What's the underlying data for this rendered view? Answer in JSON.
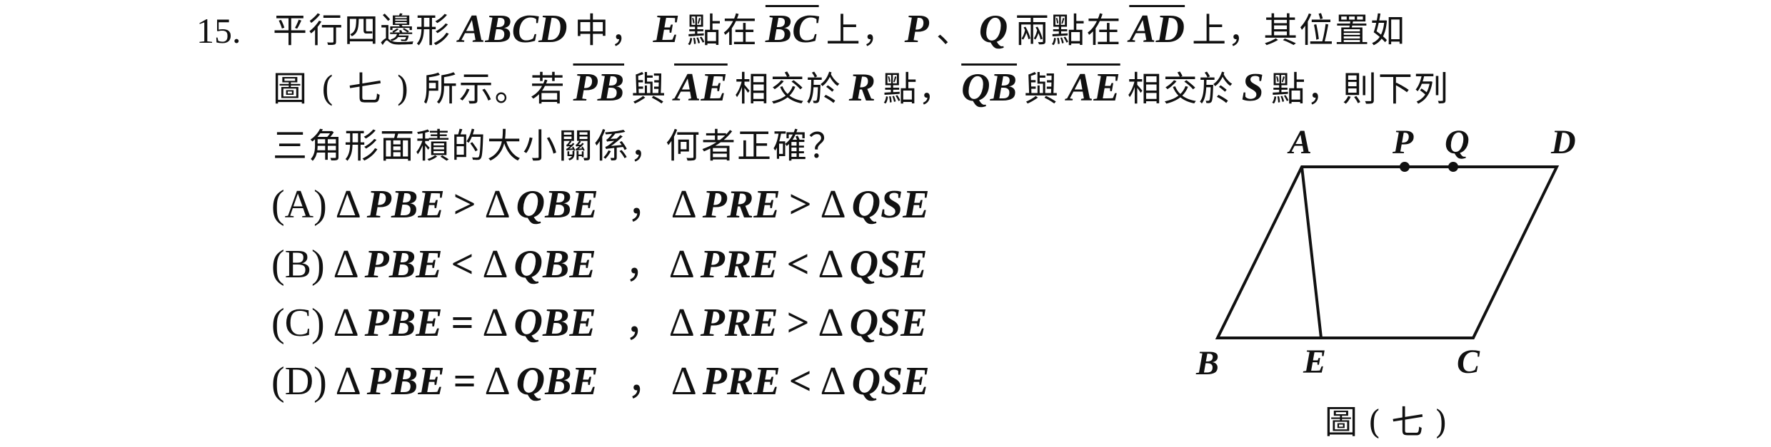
{
  "question": {
    "number": "15.",
    "line1": {
      "a": "平行四邊形",
      "v1": "ABCD",
      "b": "中，",
      "v2": "E",
      "c": "點在",
      "v3": "BC",
      "d": "上，",
      "v4": "P",
      "e": "、",
      "v5": "Q",
      "f": "兩點在",
      "v6": "AD",
      "g": "上，其位置如"
    },
    "line2": {
      "a": "圖 ( 七 ) 所示。若",
      "v1": "PB",
      "b": "與",
      "v2": "AE",
      "c": "相交於",
      "v3": "R",
      "d": "點，",
      "v4": "QB",
      "e": "與",
      "v5": "AE",
      "f": "相交於",
      "v6": "S",
      "g": "點，則下列"
    },
    "line3": "三角形面積的大小關係，何者正確？"
  },
  "options": [
    {
      "label": "(A)",
      "t1": "PBE",
      "r1": ">",
      "t2": "QBE",
      "sep": "，",
      "t3": "PRE",
      "r2": ">",
      "t4": "QSE"
    },
    {
      "label": "(B)",
      "t1": "PBE",
      "r1": "<",
      "t2": "QBE",
      "sep": "，",
      "t3": "PRE",
      "r2": "<",
      "t4": "QSE"
    },
    {
      "label": "(C)",
      "t1": "PBE",
      "r1": "=",
      "t2": "QBE",
      "sep": "，",
      "t3": "PRE",
      "r2": ">",
      "t4": "QSE"
    },
    {
      "label": "(D)",
      "t1": "PBE",
      "r1": "=",
      "t2": "QBE",
      "sep": "，",
      "t3": "PRE",
      "r2": "<",
      "t4": "QSE"
    }
  ],
  "triangle_symbol": "Δ",
  "figure": {
    "labels": {
      "A": "A",
      "P": "P",
      "Q": "Q",
      "D": "D",
      "B": "B",
      "E": "E",
      "C": "C"
    },
    "caption": "圖 ( 七 )"
  }
}
